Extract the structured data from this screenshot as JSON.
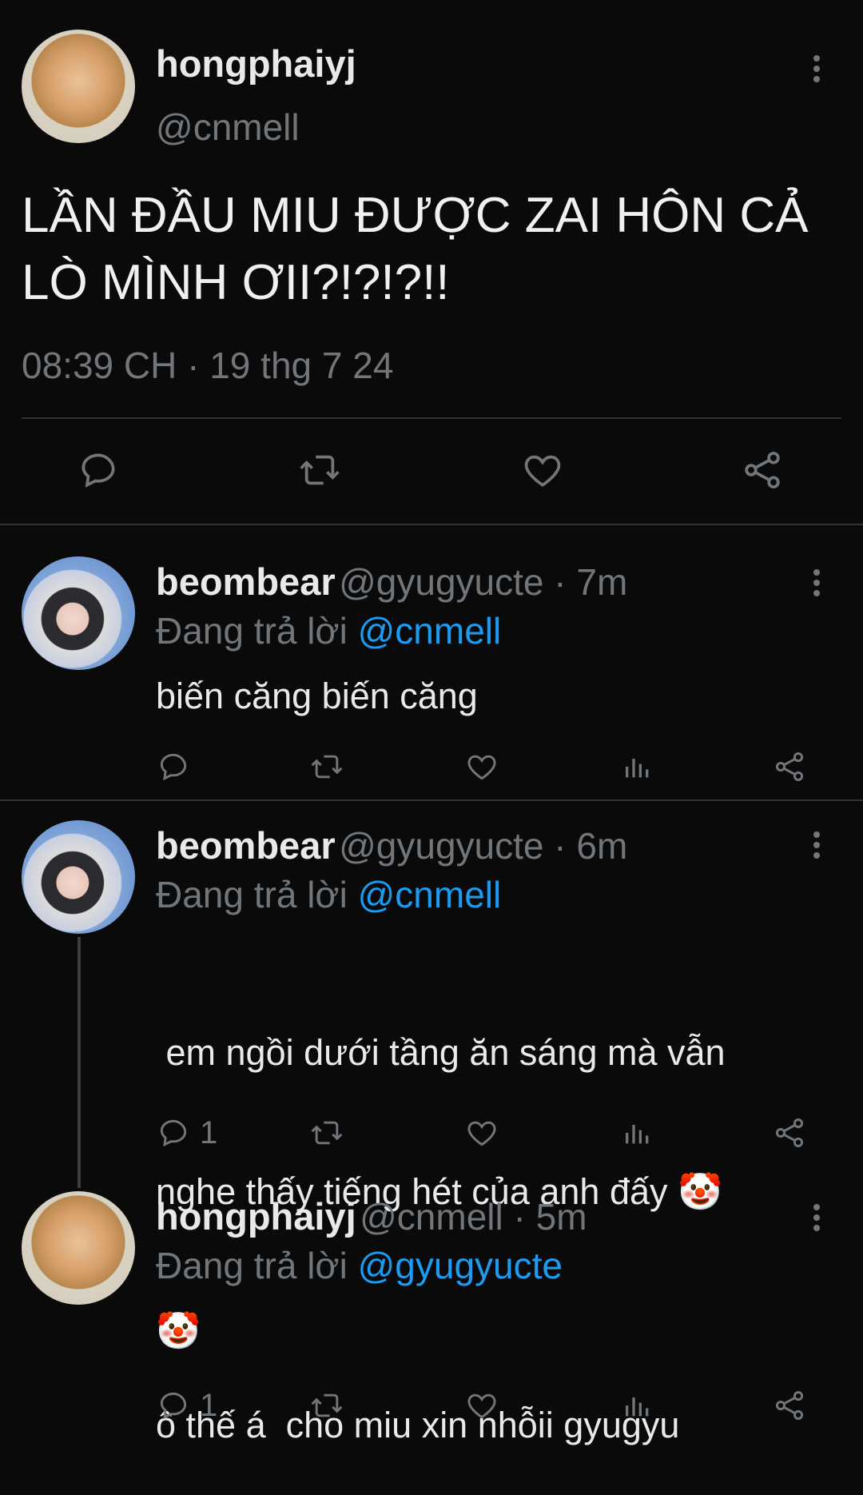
{
  "main_tweet": {
    "author_name": "hongphaiyj",
    "author_handle": "@cnmell",
    "text_line1": "LẦN ĐẦU MIU ĐƯỢC ZAI HÔN CẢ",
    "text_line2": "LÒ MÌNH ƠII?!?!?!!",
    "timestamp": "08:39 CH · 19 thg 7 24"
  },
  "replies": [
    {
      "author_name": "beombear",
      "meta": "@gyugyucte · 7m",
      "replying_prefix": "Đang trả lời ",
      "replying_to": "@cnmell",
      "text_lines": [
        "biến căng biến căng"
      ],
      "reply_count": ""
    },
    {
      "author_name": "beombear",
      "meta": "@gyugyucte · 6m",
      "replying_prefix": "Đang trả lời ",
      "replying_to": "@cnmell",
      "text_lines": [
        " em ngồi dưới tầng ăn sáng mà vẫn",
        "nghe thấy tiếng hét của anh đấy 🤡",
        "🤡"
      ],
      "reply_count": "1"
    },
    {
      "author_name": "hongphaiyj",
      "meta": "@cnmell · 5m",
      "replying_prefix": "Đang trả lời ",
      "replying_to": "@gyugyucte",
      "text_lines": [
        "ô thế á  cho miu xin nhỗii gyugyu"
      ],
      "reply_count": "1"
    }
  ],
  "icons": {
    "reply": "speech-bubble-icon",
    "retweet": "retweet-icon",
    "like": "heart-icon",
    "views": "bar-chart-icon",
    "share": "share-icon",
    "more": "kebab-menu-icon"
  },
  "colors": {
    "background": "#0a0a0a",
    "text": "#e7e9ea",
    "secondary": "#71767b",
    "link": "#1d9bf0",
    "divider": "#2f3336"
  }
}
